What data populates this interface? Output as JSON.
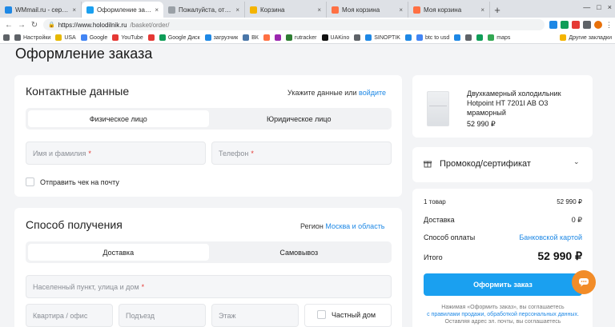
{
  "browser": {
    "tabs": [
      {
        "title": "WMmail.ru - сервис по...",
        "fav": "#1e88e5",
        "active": false
      },
      {
        "title": "Оформление заказа | х...",
        "fav": "#1aa0f0",
        "active": true
      },
      {
        "title": "Пожалуйста, отключит...",
        "fav": "#9aa0a6",
        "active": false
      },
      {
        "title": "Корзина",
        "fav": "#f4b400",
        "active": false
      },
      {
        "title": "Моя корзина",
        "fav": "#ff7043",
        "active": false
      },
      {
        "title": "Моя корзина",
        "fav": "#ff7043",
        "active": false
      }
    ],
    "tab_close": "×",
    "new_tab": "+",
    "window_controls": [
      "—",
      "□",
      "×"
    ],
    "url_host": "https://www.holodilnik.ru",
    "url_path": "/basket/order/",
    "bookmarks": [
      {
        "label": "",
        "color": "#5f6368"
      },
      {
        "label": "Настройки",
        "color": "#5f6368"
      },
      {
        "label": "USA",
        "color": "#e6b800"
      },
      {
        "label": "Google",
        "color": "#4285f4"
      },
      {
        "label": "YouTube",
        "color": "#e53935"
      },
      {
        "label": "",
        "color": "#e53935"
      },
      {
        "label": "Google Диск",
        "color": "#0f9d58"
      },
      {
        "label": "загрузчик",
        "color": "#1e88e5"
      },
      {
        "label": "ВК",
        "color": "#4a76a8"
      },
      {
        "label": "",
        "color": "#ff7043"
      },
      {
        "label": "",
        "color": "#9c27b0"
      },
      {
        "label": "rutracker",
        "color": "#2e7d32"
      },
      {
        "label": "UAKino",
        "color": "#111111"
      },
      {
        "label": "",
        "color": "#5f6368"
      },
      {
        "label": "SINOPTIK",
        "color": "#1e88e5"
      },
      {
        "label": "",
        "color": "#1e88e5"
      },
      {
        "label": "btc to usd",
        "color": "#4285f4"
      },
      {
        "label": "",
        "color": "#1e88e5"
      },
      {
        "label": "",
        "color": "#5f6368"
      },
      {
        "label": "",
        "color": "#0f9d58"
      },
      {
        "label": "maps",
        "color": "#34a853"
      }
    ],
    "other_bookmarks": "Другие закладки"
  },
  "page": {
    "title": "Оформление заказа",
    "contacts": {
      "title": "Контактные данные",
      "hint": "Укажите данные или",
      "login_link": "войдите",
      "tabs": [
        "Физическое лицо",
        "Юридическое лицо"
      ],
      "name_placeholder": "Имя и фамилия",
      "phone_placeholder": "Телефон",
      "required_mark": "*",
      "receipt_label": "Отправить чек на почту"
    },
    "delivery": {
      "title": "Способ получения",
      "region_label": "Регион",
      "region_link": "Москва и область",
      "tabs": [
        "Доставка",
        "Самовывоз"
      ],
      "address_placeholder": "Населенный пункт, улица и дом",
      "apartment_placeholder": "Квартира / офис",
      "entrance_placeholder": "Подъезд",
      "floor_placeholder": "Этаж",
      "private_house_label": "Частный дом"
    },
    "product": {
      "name": "Двухкамерный холодильник Hotpoint HT 7201I AB O3 мраморный",
      "price": "52 990 ₽"
    },
    "promo": {
      "label": "Промокод/сертификат",
      "chevron": "⌄"
    },
    "summary": {
      "items_label": "1 товар",
      "items_value": "52 990 ₽",
      "delivery_label": "Доставка",
      "delivery_value": "0 ₽",
      "payment_label": "Способ оплаты",
      "payment_value": "Банковской картой",
      "total_label": "Итого",
      "total_value": "52 990 ₽",
      "order_button": "Оформить заказ",
      "fine_1": "Нажимая «Оформить заказ», вы соглашаетесь",
      "fine_2": "с правилами продажи, обработкой персональных данных.",
      "fine_3": "Оставляя адрес эл. почты, вы соглашаетесь"
    },
    "colors": {
      "accent": "#1aa0f0",
      "link": "#1e88e5",
      "chat": "#f28c28"
    }
  }
}
